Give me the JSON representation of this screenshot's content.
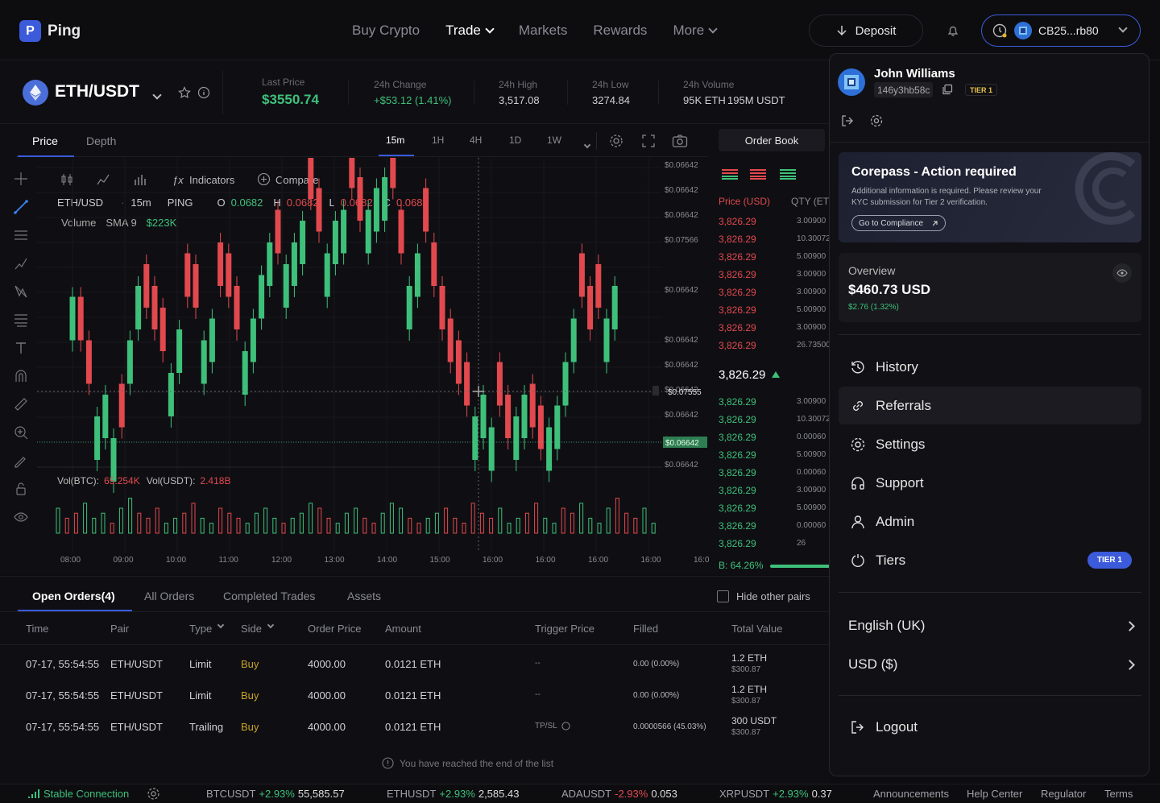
{
  "nav": {
    "brand": "Ping",
    "links": [
      "Buy Crypto",
      "Trade",
      "Markets",
      "Rewards",
      "More"
    ],
    "deposit": "Deposit",
    "account": "CB25...rb80"
  },
  "symbol": {
    "pair": "ETH/USDT",
    "last_price_label": "Last Price",
    "last_price": "$3550.74",
    "change_label": "24h Change",
    "change": "+$53.12 (1.41%)",
    "high_label": "24h High",
    "high": "3,517.08",
    "low_label": "24h Low",
    "low": "3274.84",
    "volume_label": "24h Volume",
    "volume_eth": "95K ETH",
    "volume_usdt": "195M USDT"
  },
  "chart": {
    "tabs": [
      "Price",
      "Depth"
    ],
    "intervals": [
      "15m",
      "1H",
      "4H",
      "1D",
      "1W"
    ],
    "active_interval": "15m",
    "indicators": "Indicators",
    "compare": "Compare",
    "legend": {
      "pair": "ETH/USD",
      "interval": "15m",
      "exchange": "PING",
      "o_label": "O",
      "o": "0.0682",
      "h_label": "H",
      "h": "0.0682",
      "l_label": "L",
      "l": "0.0682",
      "c_label": "C",
      "c": "0.0682"
    },
    "volume_legend": {
      "label": "Volume",
      "sma": "SMA 9",
      "sma_val": "$223K"
    },
    "vol_row": {
      "btc_label": "Vol(BTC):",
      "btc": "65.254K",
      "usdt_label": "Vol(USDT):",
      "usdt": "2.418B"
    },
    "y_ticks": [
      "$0.06642",
      "$0.06642",
      "$0.06642",
      "$0.07566",
      "$0.07555",
      "$0.06642",
      "$0.06642",
      "$0.06642",
      "$0.06642",
      "$0.06642",
      "$0.06642",
      "$0.06642",
      "$0.06642"
    ],
    "cross_label": "$0.07555",
    "current_label": "$0.06642",
    "x_ticks": [
      "08:00",
      "09:00",
      "10:00",
      "11:00",
      "12:00",
      "13:00",
      "14:00",
      "15:00",
      "16:00",
      "16:00",
      "16:00",
      "16:00",
      "16:0"
    ]
  },
  "chart_data": {
    "type": "candlestick",
    "candles": [
      [
        5,
        "u"
      ],
      [
        1,
        "d"
      ],
      [
        -3,
        "d"
      ],
      [
        -6,
        "u"
      ],
      [
        -4,
        "u"
      ],
      [
        -8,
        "u"
      ],
      [
        -7,
        "d"
      ],
      [
        1,
        "u"
      ],
      [
        6,
        "u"
      ],
      [
        4,
        "d"
      ],
      [
        2,
        "d"
      ],
      [
        0,
        "d"
      ],
      [
        -2,
        "u"
      ],
      [
        2,
        "u"
      ],
      [
        5,
        "d"
      ],
      [
        4,
        "d"
      ],
      [
        1,
        "u"
      ],
      [
        3,
        "u"
      ],
      [
        6,
        "d"
      ],
      [
        5,
        "d"
      ],
      [
        2,
        "d"
      ],
      [
        0,
        "u"
      ],
      [
        3,
        "u"
      ],
      [
        7,
        "u"
      ],
      [
        10,
        "u"
      ],
      [
        9,
        "d"
      ],
      [
        8,
        "u"
      ],
      [
        10,
        "u"
      ],
      [
        12,
        "u"
      ],
      [
        14,
        "d"
      ],
      [
        11,
        "d"
      ],
      [
        9,
        "u"
      ],
      [
        12,
        "u"
      ],
      [
        13,
        "u"
      ],
      [
        15,
        "d"
      ],
      [
        12,
        "d"
      ],
      [
        13,
        "u"
      ],
      [
        15,
        "u"
      ],
      [
        16,
        "u"
      ],
      [
        15,
        "d"
      ],
      [
        9,
        "d"
      ],
      [
        6,
        "u"
      ],
      [
        9,
        "u"
      ],
      [
        11,
        "d"
      ],
      [
        6,
        "d"
      ],
      [
        2,
        "d"
      ],
      [
        -1,
        "d"
      ],
      [
        -3,
        "d"
      ],
      [
        -5,
        "d"
      ],
      [
        -6,
        "u"
      ],
      [
        -4,
        "u"
      ],
      [
        -7,
        "u"
      ],
      [
        -5,
        "d"
      ],
      [
        -8,
        "d"
      ],
      [
        -6,
        "u"
      ],
      [
        -4,
        "u"
      ],
      [
        -7,
        "d"
      ],
      [
        -9,
        "d"
      ],
      [
        -7,
        "u"
      ],
      [
        -5,
        "u"
      ],
      [
        -1,
        "u"
      ],
      [
        3,
        "u"
      ],
      [
        5,
        "d"
      ],
      [
        2,
        "d"
      ],
      [
        4,
        "d"
      ],
      [
        3,
        "u"
      ],
      [
        6,
        "u"
      ]
    ],
    "volumes": [
      5,
      3,
      4,
      6,
      3,
      4,
      2,
      5,
      7,
      4,
      3,
      5,
      2,
      3,
      4,
      6,
      3,
      2,
      5,
      4,
      3,
      2,
      4,
      5,
      3,
      2,
      3,
      4,
      6,
      5,
      3,
      2,
      4,
      5,
      3,
      2,
      4,
      6,
      5,
      3,
      2,
      3,
      4,
      5,
      3,
      2,
      6,
      4,
      3,
      5,
      2,
      3,
      4,
      6,
      3,
      2,
      5,
      4,
      6,
      3,
      2,
      5,
      7,
      4,
      3,
      5,
      2
    ]
  },
  "orderbook": {
    "tab": "Order Book",
    "price_header": "Price (USD)",
    "qty_header": "QTY (ET",
    "asks": [
      [
        "3,826.29",
        "3.00900"
      ],
      [
        "3,826.29",
        "10.30072"
      ],
      [
        "3,826.29",
        "5.00900"
      ],
      [
        "3,826.29",
        "3.00900"
      ],
      [
        "3,826.29",
        "3.00900"
      ],
      [
        "3,826.29",
        "5.00900"
      ],
      [
        "3,826.29",
        "3.00900"
      ],
      [
        "3,826.29",
        "26.73500"
      ]
    ],
    "mid": "3,826.29",
    "bids": [
      [
        "3,826.29",
        "3.00900"
      ],
      [
        "3,826.29",
        "10.30072"
      ],
      [
        "3,826.29",
        "0.00060"
      ],
      [
        "3,826.29",
        "5.00900"
      ],
      [
        "3,826.29",
        "0.00060"
      ],
      [
        "3,826.29",
        "3.00900"
      ],
      [
        "3,826.29",
        "5.00900"
      ],
      [
        "3,826.29",
        "0.00060"
      ],
      [
        "3,826.29",
        "26"
      ]
    ],
    "ratio_label": "B: 64.26%"
  },
  "orders": {
    "tabs": [
      "Open Orders(4)",
      "All Orders",
      "Completed Trades",
      "Assets"
    ],
    "hide_pairs": "Hide other pairs",
    "headers": [
      "Time",
      "Pair",
      "Type",
      "Side",
      "Order Price",
      "Amount",
      "Trigger Price",
      "Filled",
      "Total Value"
    ],
    "rows": [
      {
        "time": "07-17, 55:54:55",
        "pair": "ETH/USDT",
        "type": "Limit",
        "side": "Buy",
        "price": "4000.00",
        "amount": "0.0121 ETH",
        "trigger": "--",
        "filled": "0.00 (0.00%)",
        "total": "1.2 ETH",
        "total_sub": "$300.87"
      },
      {
        "time": "07-17, 55:54:55",
        "pair": "ETH/USDT",
        "type": "Limit",
        "side": "Buy",
        "price": "4000.00",
        "amount": "0.0121 ETH",
        "trigger": "--",
        "filled": "0.00 (0.00%)",
        "total": "1.2 ETH",
        "total_sub": "$300.87"
      },
      {
        "time": "07-17, 55:54:55",
        "pair": "ETH/USDT",
        "type": "Trailing",
        "side": "Buy",
        "price": "4000.00",
        "amount": "0.0121 ETH",
        "trigger": "TP/SL",
        "filled": "0.0000566 (45.03%)",
        "total": "300 USDT",
        "total_sub": "$300.87"
      }
    ],
    "end_note": "You have reached the end of the list"
  },
  "footer": {
    "connection": "Stable Connection",
    "tickers": [
      {
        "sym": "BTCUSDT",
        "chg": "+2.93%",
        "price": "55,585.57",
        "up": true
      },
      {
        "sym": "ETHUSDT",
        "chg": "+2.93%",
        "price": "2,585.43",
        "up": true
      },
      {
        "sym": "ADAUSDT",
        "chg": "-2.93%",
        "price": "0.053",
        "up": false
      },
      {
        "sym": "XRPUSDT",
        "chg": "+2.93%",
        "price": "0.37",
        "up": true
      }
    ],
    "links": [
      "Announcements",
      "Help Center",
      "Regulator",
      "Terms"
    ]
  },
  "panel": {
    "name": "John Williams",
    "uid": "146y3hb58c",
    "tier_badge": "TIER 1",
    "banner_title": "Corepass - Action required",
    "banner_text": "Additional information is required. Please review your KYC submission for Tier 2 verification.",
    "banner_button": "Go to Compliance",
    "overview_label": "Overview",
    "overview_value": "$460.73 USD",
    "overview_change": "$2.76 (1.32%)",
    "menu": [
      "History",
      "Referrals",
      "Settings",
      "Support",
      "Admin",
      "Tiers"
    ],
    "tiers_pill": "TIER 1",
    "language": "English (UK)",
    "currency": "USD ($)",
    "logout": "Logout"
  },
  "colors": {
    "accent": "#3b5bdb",
    "up": "#3ec07a",
    "down": "#e2494e",
    "bg": "#0d0d10"
  }
}
